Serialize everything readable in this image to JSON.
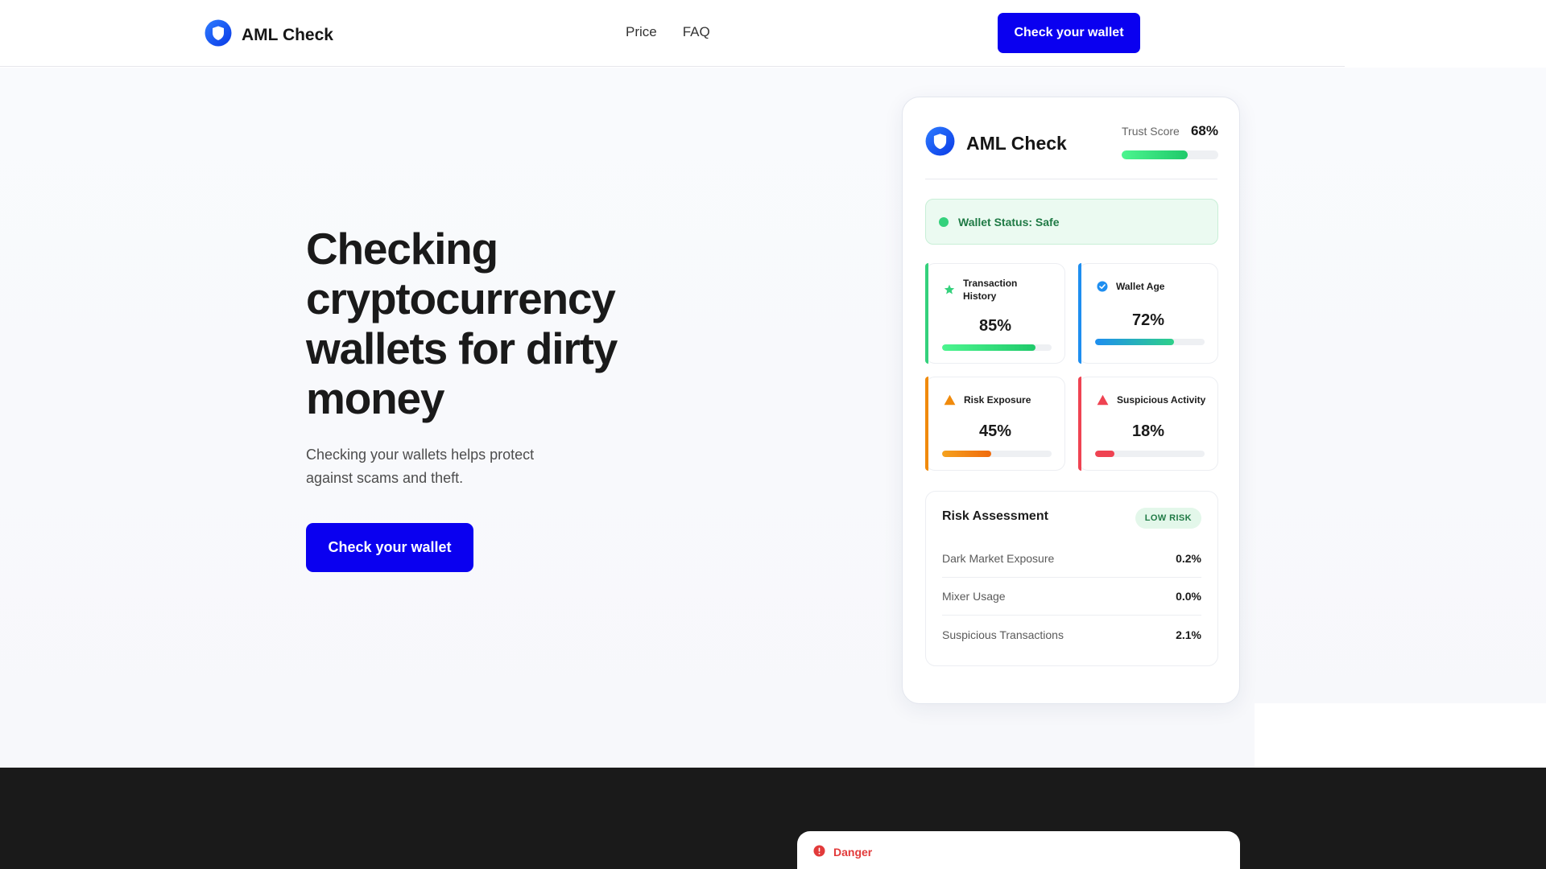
{
  "header": {
    "logo_text": "AML Check",
    "nav": [
      "Price",
      "FAQ"
    ],
    "cta": "Check your wallet",
    "logo_icon": "shield-icon"
  },
  "hero": {
    "title": "Checking cryptocurrency wallets for dirty money",
    "subtitle": "Checking your wallets helps protect against scams and theft.",
    "cta": "Check your wallet"
  },
  "card": {
    "brand": "AML Check",
    "trust_label": "Trust Score",
    "trust_value": "68%",
    "trust_level": 0.68,
    "status_text": "Wallet Status: Safe",
    "metrics": [
      {
        "label": "Transaction History",
        "value": "85%",
        "level": 0.85,
        "icon": "star-icon",
        "color": "#34d17c"
      },
      {
        "label": "Wallet Age",
        "value": "72%",
        "level": 0.72,
        "icon": "check-badge-icon",
        "color": "#1e8ef0"
      },
      {
        "label": "Risk Exposure",
        "value": "45%",
        "level": 0.45,
        "icon": "warning-icon",
        "color": "#f08a0c"
      },
      {
        "label": "Suspicious Activity",
        "value": "18%",
        "level": 0.18,
        "icon": "alert-triangle-icon",
        "color": "#ef4352"
      }
    ],
    "risk": {
      "title": "Risk Assessment",
      "badge": "LOW RISK",
      "rows": [
        {
          "label": "Dark Market Exposure",
          "value": "0.2%"
        },
        {
          "label": "Mixer Usage",
          "value": "0.0%"
        },
        {
          "label": "Suspicious Transactions",
          "value": "2.1%"
        }
      ]
    }
  },
  "danger": {
    "label": "Danger"
  },
  "colors": {
    "primary": "#0a00f0",
    "success": "#34d17c",
    "info": "#1e8ef0",
    "warning": "#f08a0c",
    "danger": "#ef4352",
    "dark_section": "#1a1a1a"
  }
}
